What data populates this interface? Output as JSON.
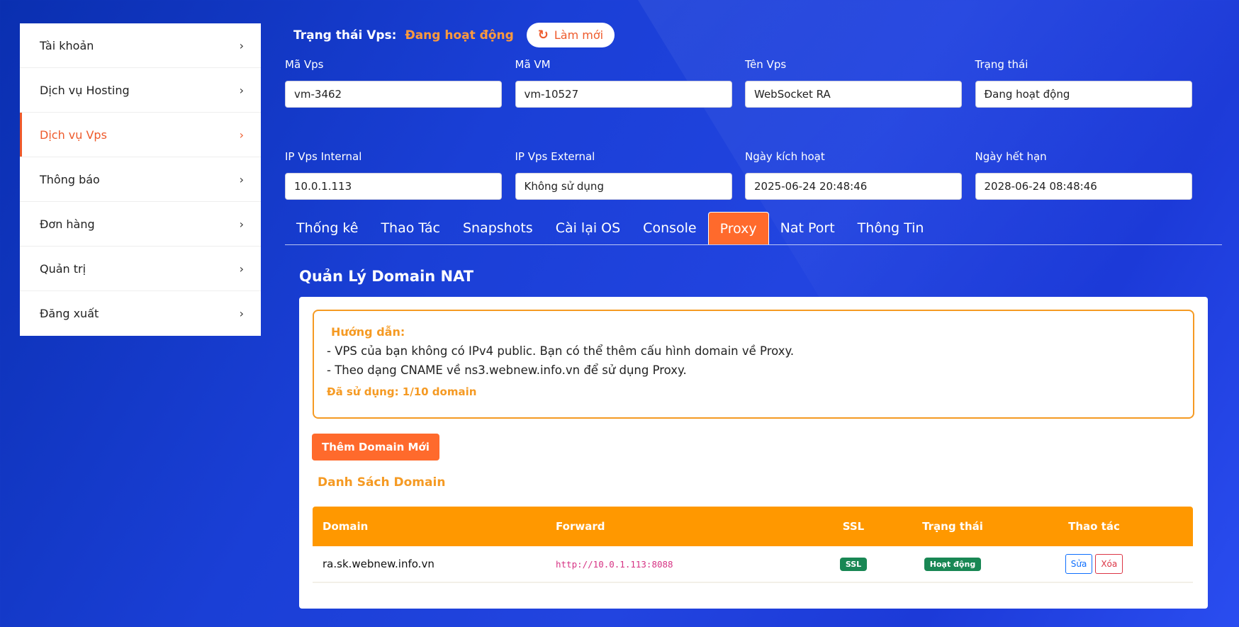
{
  "sidebar": {
    "items": [
      {
        "label": "Tài khoản"
      },
      {
        "label": "Dịch vụ Hosting"
      },
      {
        "label": "Dịch vụ Vps"
      },
      {
        "label": "Thông báo"
      },
      {
        "label": "Đơn hàng"
      },
      {
        "label": "Quản trị"
      },
      {
        "label": "Đăng xuất"
      }
    ],
    "active_index": 2
  },
  "header": {
    "status_label": "Trạng thái Vps:",
    "status_value": "Đang hoạt động",
    "refresh_label": "Làm mới"
  },
  "fields": {
    "ma_vps": {
      "label": "Mã Vps",
      "value": "vm-3462"
    },
    "ma_vm": {
      "label": "Mã VM",
      "value": "vm-10527"
    },
    "ten_vps": {
      "label": "Tên Vps",
      "value": "WebSocket RA"
    },
    "trang_thai": {
      "label": "Trạng thái",
      "value": "Đang hoạt động"
    },
    "ip_internal": {
      "label": "IP Vps Internal",
      "value": "10.0.1.113"
    },
    "ip_external": {
      "label": "IP Vps External",
      "value": "Không sử dụng"
    },
    "ngay_kich_hoat": {
      "label": "Ngày kích hoạt",
      "value": "2025-06-24 20:48:46"
    },
    "ngay_het_han": {
      "label": "Ngày hết hạn",
      "value": "2028-06-24 08:48:46"
    }
  },
  "tabs": [
    {
      "label": "Thống kê"
    },
    {
      "label": "Thao Tác"
    },
    {
      "label": "Snapshots"
    },
    {
      "label": "Cài lại OS"
    },
    {
      "label": "Console"
    },
    {
      "label": "Proxy"
    },
    {
      "label": "Nat Port"
    },
    {
      "label": "Thông Tin"
    }
  ],
  "active_tab": "Proxy",
  "section": {
    "title": "Quản Lý Domain NAT",
    "guide_title": "Hướng dẫn:",
    "guide_line1": "- VPS của bạn không có IPv4 public. Bạn có thể thêm cấu hình domain về Proxy.",
    "guide_line2": "- Theo dạng CNAME về ns3.webnew.info.vn để sử dụng Proxy.",
    "guide_used": "Đã sử dụng: 1/10 domain",
    "add_button": "Thêm Domain Mới",
    "list_title": "Danh Sách Domain"
  },
  "table": {
    "headers": {
      "domain": "Domain",
      "forward": "Forward",
      "ssl": "SSL",
      "status": "Trạng thái",
      "action": "Thao tác"
    },
    "rows": [
      {
        "domain": "ra.sk.webnew.info.vn",
        "forward": "http://10.0.1.113:8088",
        "ssl": "SSL",
        "status": "Hoạt động",
        "edit": "Sửa",
        "delete": "Xóa"
      }
    ]
  },
  "colors": {
    "accent": "#ff6a2c",
    "warning": "#f59a23",
    "table_header": "#ff9800",
    "success": "#198754"
  }
}
